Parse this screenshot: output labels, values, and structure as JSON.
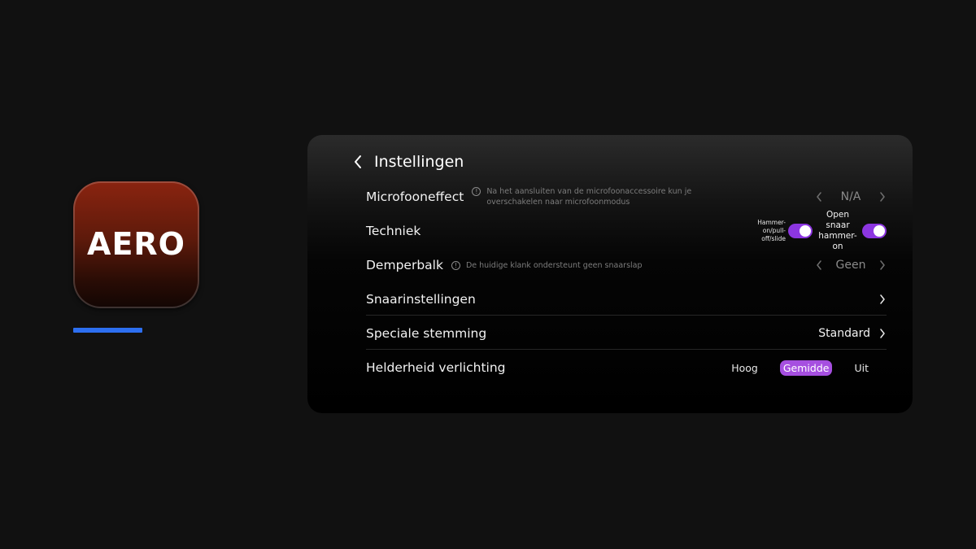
{
  "app": {
    "icon_text": "AERO"
  },
  "header": {
    "title": "Instellingen"
  },
  "rows": {
    "microfoon": {
      "label": "Microfooneffect",
      "info": "Na het aansluiten van de microfoonaccessoire kun je overschakelen naar microfoonmodus",
      "value": "N/A"
    },
    "techniek": {
      "label": "Techniek",
      "toggle1_label": "Hammer-on/pull-off/slide",
      "toggle1_on": true,
      "toggle2_label": "Open snaar hammer-on",
      "toggle2_on": true
    },
    "demper": {
      "label": "Demperbalk",
      "info": "De huidige klank ondersteunt geen snaarslap",
      "value": "Geen"
    },
    "snaar": {
      "label": "Snaarinstellingen"
    },
    "stemming": {
      "label": "Speciale stemming",
      "value": "Standard"
    },
    "helderheid": {
      "label": "Helderheid verlichting",
      "options": [
        "Hoog",
        "Gemidde",
        "Uit"
      ],
      "selected": "Gemidde"
    }
  },
  "colors": {
    "accent": "#8c36e0",
    "accent_selected": "#a64fe0",
    "indicator": "#2d6ff0",
    "icon_bg": "#5e1a0b"
  }
}
